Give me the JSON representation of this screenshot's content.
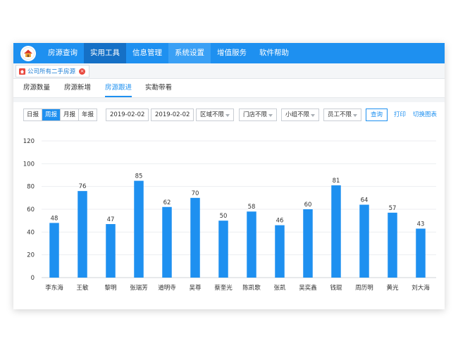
{
  "nav": {
    "items": [
      {
        "label": "房源查询",
        "state": "normal"
      },
      {
        "label": "实用工具",
        "state": "active"
      },
      {
        "label": "信息管理",
        "state": "normal"
      },
      {
        "label": "系统设置",
        "state": "highlight"
      },
      {
        "label": "增值服务",
        "state": "normal"
      },
      {
        "label": "软件帮助",
        "state": "normal"
      }
    ],
    "logo_icon": "house-logo-icon",
    "color": "#1e90f0"
  },
  "page_tab": {
    "label": "公司所有二手房源",
    "icon": "home-icon",
    "close_icon": "close-icon"
  },
  "subtabs": [
    {
      "label": "房源数量"
    },
    {
      "label": "房源新增"
    },
    {
      "label": "房源跟进"
    },
    {
      "label": "实勘带看"
    }
  ],
  "subtabs_active_index": 2,
  "filter": {
    "periods": [
      "日报",
      "周报",
      "月报",
      "年报"
    ],
    "active_period_index": 1,
    "date_start": "2019-02-02",
    "date_end": "2019-02-02",
    "selects": [
      "区域不限",
      "门店不限",
      "小组不限",
      "员工不限"
    ],
    "query_label": "查询",
    "print_label": "打印",
    "switch_label": "切换图表"
  },
  "chart_data": {
    "type": "bar",
    "categories": [
      "李东海",
      "王敏",
      "黎明",
      "张瑞芳",
      "道明寺",
      "吴尊",
      "蔡奎光",
      "陈凯歌",
      "张凯",
      "吴奕鑫",
      "钱琨",
      "周历明",
      "黄光",
      "刘大海"
    ],
    "values": [
      48,
      76,
      47,
      85,
      62,
      70,
      50,
      58,
      46,
      60,
      81,
      64,
      57,
      43
    ],
    "ylim": [
      0,
      120
    ],
    "yticks": [
      0,
      20,
      40,
      60,
      80,
      100,
      120
    ],
    "grid": true,
    "bar_color": "#1e90f0"
  }
}
